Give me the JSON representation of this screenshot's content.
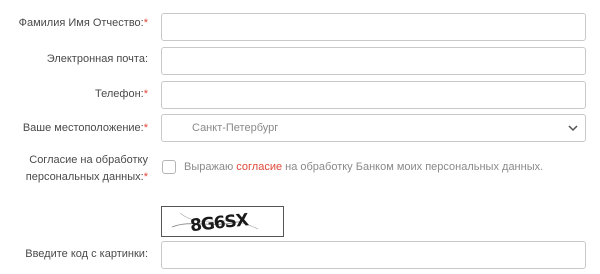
{
  "form": {
    "required_mark": "*",
    "fio": {
      "label": "Фамилия Имя Отчество:",
      "value": ""
    },
    "email": {
      "label": "Электронная почта:",
      "value": ""
    },
    "phone": {
      "label": "Телефон:",
      "value": ""
    },
    "location": {
      "label": "Ваше местоположение:",
      "selected": "Санкт-Петербург"
    },
    "consent": {
      "label_line1": "Согласие на обработку",
      "label_line2": "персональных данных:",
      "text_before": "Выражаю ",
      "link_text": "согласие",
      "text_after": " на обработку Банком моих персональных данных.",
      "checked": false
    },
    "captcha": {
      "image_text": "8G6SX",
      "label": "Введите код с картинки:",
      "value": ""
    }
  },
  "colors": {
    "required": "#e0473a",
    "link": "#e0473a",
    "border": "#c9c9c9"
  },
  "icons": {
    "select_arrow": "chevron-down-icon"
  }
}
